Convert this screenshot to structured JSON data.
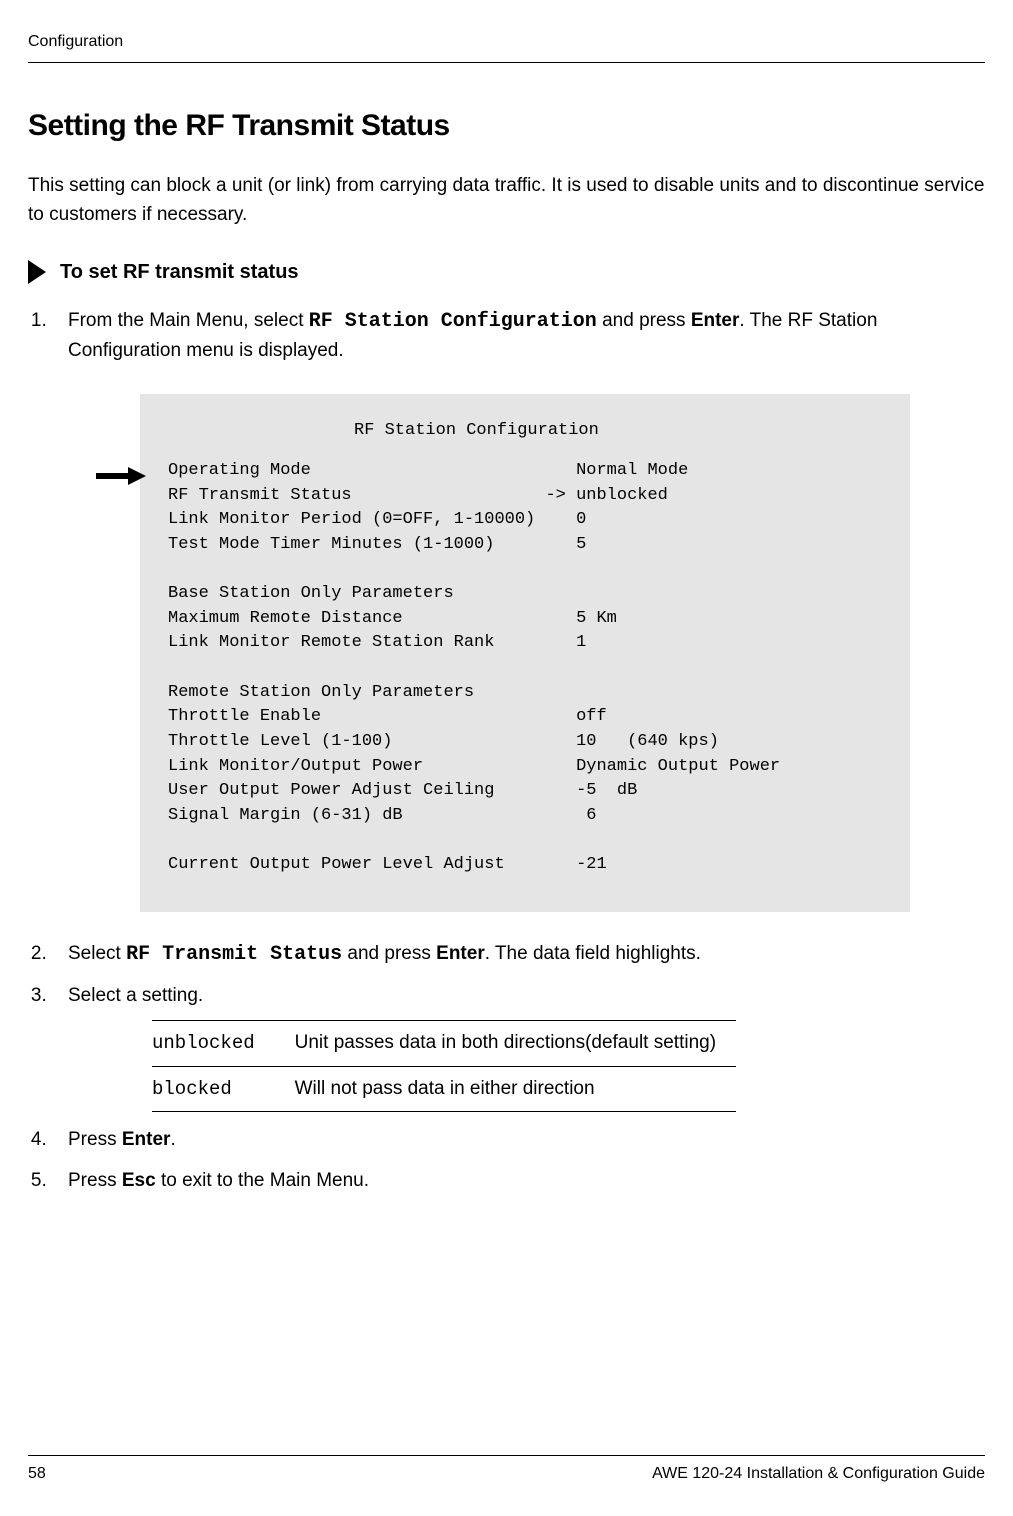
{
  "header": {
    "section": "Configuration"
  },
  "title": "Setting the RF Transmit Status",
  "intro": "This setting can block a unit (or link) from carrying data traffic. It is used to disable units and to discontinue service to customers if necessary.",
  "task_title": "To set RF transmit status",
  "steps": {
    "s1_a": "From the Main Menu, select ",
    "s1_code": "RF Station Configuration",
    "s1_b": " and press ",
    "s1_key": "Enter",
    "s1_c": ". The RF Station Configuration menu is displayed.",
    "s2_a": "Select ",
    "s2_code": "RF Transmit Status",
    "s2_b": " and press ",
    "s2_key": "Enter",
    "s2_c": ". The data field highlights.",
    "s3": "Select a setting.",
    "s4_a": "Press ",
    "s4_key": "Enter",
    "s4_b": ".",
    "s5_a": "Press ",
    "s5_key": "Esc",
    "s5_b": " to exit to the Main Menu."
  },
  "screen": {
    "title": "RF Station Configuration",
    "body": "Operating Mode                          Normal Mode\nRF Transmit Status                   -> unblocked\nLink Monitor Period (0=OFF, 1-10000)    0\nTest Mode Timer Minutes (1-1000)        5\n\nBase Station Only Parameters\nMaximum Remote Distance                 5 Km\nLink Monitor Remote Station Rank        1\n\nRemote Station Only Parameters\nThrottle Enable                         off\nThrottle Level (1-100)                  10   (640 kps)\nLink Monitor/Output Power               Dynamic Output Power\nUser Output Power Adjust Ceiling        -5  dB\nSignal Margin (6-31) dB                  6\n\nCurrent Output Power Level Adjust       -21"
  },
  "table": {
    "rows": [
      {
        "key": "unblocked",
        "desc": "Unit passes data in both directions(default setting)"
      },
      {
        "key": "blocked",
        "desc": "Will not pass data in either direction"
      }
    ]
  },
  "footer": {
    "page": "58",
    "doc": "AWE 120-24 Installation & Configuration Guide"
  }
}
